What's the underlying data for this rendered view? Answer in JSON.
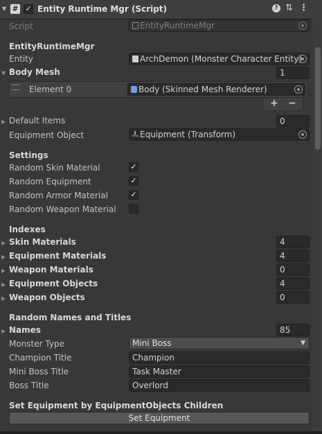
{
  "header": {
    "title": "Entity Runtime Mgr (Script)",
    "help_icon": "help-icon",
    "preset_icon": "sliders-icon",
    "menu_icon": "kebab-menu-icon",
    "enabled": true
  },
  "script_field": {
    "label": "Script",
    "value": "EntityRuntimeMgr"
  },
  "sections": {
    "entity_runtime_mgr": "EntityRuntimeMgr",
    "settings": "Settings",
    "indexes": "Indexes",
    "random_names": "Random Names and Titles",
    "set_equipment": "Set Equipment by EquipmentObjects Children"
  },
  "entity": {
    "label": "Entity",
    "value": "ArchDemon (Monster Character Entity)"
  },
  "body_mesh": {
    "label": "Body Mesh",
    "count": "1",
    "element_label": "Element 0",
    "element_value": "Body (Skinned Mesh Renderer)",
    "plus": "+",
    "minus": "−"
  },
  "default_items": {
    "label": "Default Items",
    "count": "0"
  },
  "equipment_object": {
    "label": "Equipment Object",
    "value": "Equipment (Transform)"
  },
  "settings": [
    {
      "label": "Random Skin Material",
      "checked": true,
      "mark": "✓"
    },
    {
      "label": "Random Equipment",
      "checked": true,
      "mark": "✓"
    },
    {
      "label": "Random Armor Material",
      "checked": true,
      "mark": "✓"
    },
    {
      "label": "Random Weapon Material",
      "checked": false,
      "mark": ""
    }
  ],
  "indexes": [
    {
      "label": "Skin Materials",
      "value": "4"
    },
    {
      "label": "Equipment Materials",
      "value": "4"
    },
    {
      "label": "Weapon Materials",
      "value": "0"
    },
    {
      "label": "Equipment Objects",
      "value": "4"
    },
    {
      "label": "Weapon Objects",
      "value": "0"
    }
  ],
  "names": {
    "label": "Names",
    "value": "85"
  },
  "monster_type": {
    "label": "Monster Type",
    "value": "Mini Boss"
  },
  "titles": [
    {
      "label": "Champion Title",
      "value": "Champion"
    },
    {
      "label": "Mini Boss Title",
      "value": "Task Master"
    },
    {
      "label": "Boss Title",
      "value": "Overlord"
    }
  ],
  "set_equipment_button": "Set Equipment"
}
